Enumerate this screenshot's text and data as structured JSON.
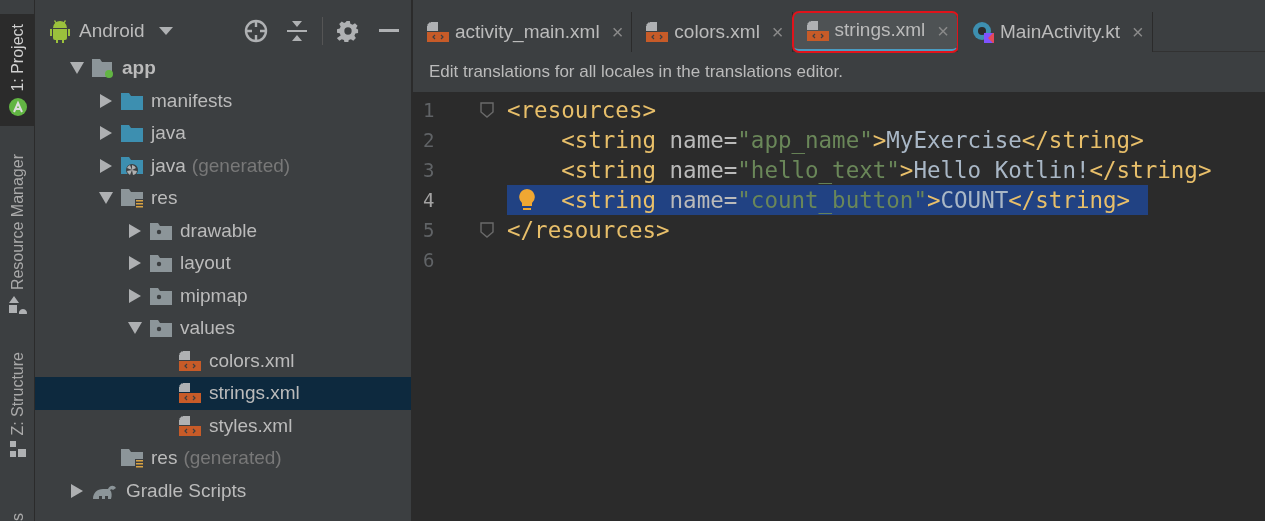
{
  "tool_stripe": [
    {
      "label": "1: Project",
      "selected": true
    },
    {
      "label": "Resource Manager",
      "selected": false
    },
    {
      "label": "Z: Structure",
      "selected": false
    },
    {
      "label": "s",
      "selected": false
    }
  ],
  "project_panel": {
    "view": "Android",
    "tree": [
      {
        "label": "app",
        "kind": "module",
        "bold": true,
        "expanded": true,
        "selected": false,
        "children": [
          {
            "label": "manifests",
            "kind": "folder",
            "expanded": false,
            "selected": false
          },
          {
            "label": "java",
            "kind": "folder",
            "expanded": false,
            "selected": false
          },
          {
            "label": "java",
            "suffix": "(generated)",
            "kind": "generated",
            "expanded": false,
            "selected": false
          },
          {
            "label": "res",
            "kind": "resources",
            "expanded": true,
            "selected": false,
            "children": [
              {
                "label": "drawable",
                "kind": "package",
                "expanded": false,
                "selected": false
              },
              {
                "label": "layout",
                "kind": "package",
                "expanded": false,
                "selected": false
              },
              {
                "label": "mipmap",
                "kind": "package",
                "expanded": false,
                "selected": false
              },
              {
                "label": "values",
                "kind": "package",
                "expanded": true,
                "selected": false,
                "children": [
                  {
                    "label": "colors.xml",
                    "kind": "xml",
                    "selected": false
                  },
                  {
                    "label": "strings.xml",
                    "kind": "xml",
                    "selected": true
                  },
                  {
                    "label": "styles.xml",
                    "kind": "xml",
                    "selected": false
                  }
                ]
              }
            ]
          },
          {
            "label": "res",
            "suffix": "(generated)",
            "kind": "resources",
            "selected": false
          }
        ]
      },
      {
        "label": "Gradle Scripts",
        "kind": "gradle",
        "expanded": false,
        "selected": false
      }
    ]
  },
  "tabs": [
    {
      "label": "activity_main.xml",
      "kind": "xml",
      "selected": false,
      "outlined": false,
      "close": "×"
    },
    {
      "label": "colors.xml",
      "kind": "xml",
      "selected": false,
      "outlined": false,
      "close": "×"
    },
    {
      "label": "strings.xml",
      "kind": "xml",
      "selected": true,
      "outlined": true,
      "close": "×"
    },
    {
      "label": "MainActivity.kt",
      "kind": "kotlin",
      "selected": false,
      "outlined": false,
      "close": "×"
    }
  ],
  "banner": "Edit translations for all locales in the translations editor.",
  "editor": {
    "lines": [
      {
        "number": "1",
        "fold": true,
        "highlighted": false,
        "bulb": false,
        "tokens": [
          {
            "kind": "tag",
            "text": "<resources>"
          }
        ]
      },
      {
        "number": "2",
        "fold": false,
        "highlighted": false,
        "bulb": false,
        "tokens": [
          {
            "kind": "tag",
            "text": "    <string "
          },
          {
            "kind": "attr",
            "text": "name="
          },
          {
            "kind": "value",
            "text": "\"app_name\""
          },
          {
            "kind": "tag",
            "text": ">"
          },
          {
            "kind": "text",
            "text": "MyExercise"
          },
          {
            "kind": "tag",
            "text": "</string>"
          }
        ]
      },
      {
        "number": "3",
        "fold": false,
        "highlighted": false,
        "bulb": false,
        "tokens": [
          {
            "kind": "tag",
            "text": "    <string "
          },
          {
            "kind": "attr",
            "text": "name="
          },
          {
            "kind": "value",
            "text": "\"hello_text\""
          },
          {
            "kind": "tag",
            "text": ">"
          },
          {
            "kind": "text",
            "text": "Hello Kotlin!"
          },
          {
            "kind": "tag",
            "text": "</string>"
          }
        ]
      },
      {
        "number": "4",
        "fold": false,
        "highlighted": true,
        "bulb": true,
        "tokens": [
          {
            "kind": "tag",
            "text": "    <string "
          },
          {
            "kind": "attr",
            "text": "name="
          },
          {
            "kind": "value",
            "text": "\"count_button\""
          },
          {
            "kind": "tag",
            "text": ">"
          },
          {
            "kind": "text",
            "text": "COUNT"
          },
          {
            "kind": "tag",
            "text": "</string>"
          }
        ]
      },
      {
        "number": "5",
        "fold": true,
        "highlighted": false,
        "bulb": false,
        "tokens": [
          {
            "kind": "tag",
            "text": "</resources>"
          }
        ]
      },
      {
        "number": "6",
        "fold": false,
        "highlighted": false,
        "bulb": false
      }
    ]
  }
}
